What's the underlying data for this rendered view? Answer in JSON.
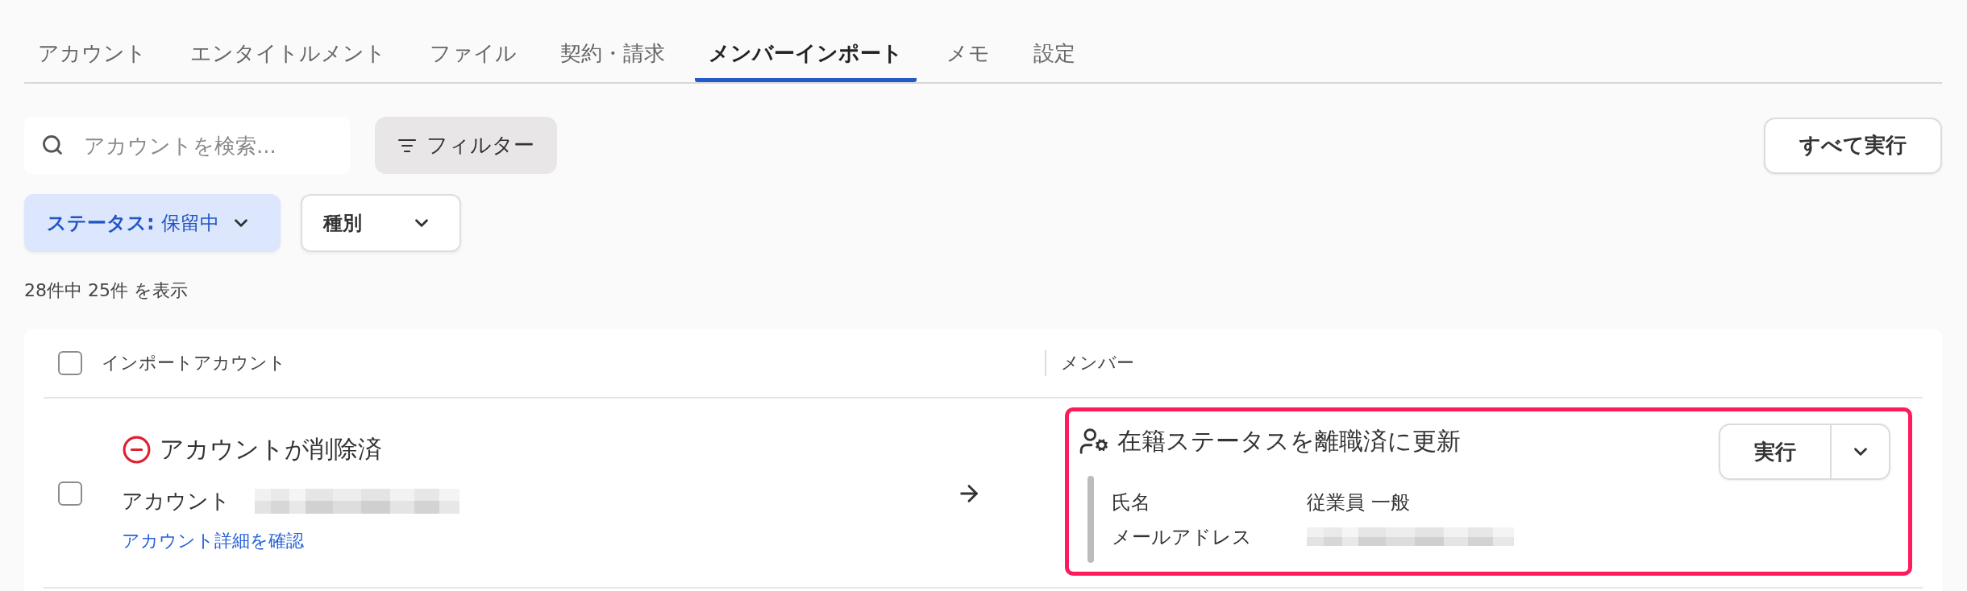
{
  "tabs": [
    {
      "label": "アカウント",
      "selected": false
    },
    {
      "label": "エンタイトルメント",
      "selected": false
    },
    {
      "label": "ファイル",
      "selected": false
    },
    {
      "label": "契約・請求",
      "selected": false
    },
    {
      "label": "メンバーインポート",
      "selected": true
    },
    {
      "label": "メモ",
      "selected": false
    },
    {
      "label": "設定",
      "selected": false
    }
  ],
  "toolbar": {
    "search": {
      "placeholder": "アカウントを検索..."
    },
    "filter_button": {
      "label": "フィルター"
    },
    "run_all_button": {
      "label": "すべて実行"
    }
  },
  "filters": [
    {
      "label": "ステータス:",
      "value": "保留中",
      "active": true
    },
    {
      "label": "種別",
      "active": false
    }
  ],
  "result_count": "28件中 25件 を表示",
  "table": {
    "columns": [
      "インポートアカウント",
      "メンバー"
    ],
    "select_all": {
      "checked": false
    },
    "rows": [
      {
        "checked": false,
        "account": {
          "status": {
            "kind": "deleted",
            "label": "アカウントが削除済"
          },
          "label": "アカウント",
          "value_redacted": true,
          "detail_link": "アカウント詳細を確認"
        },
        "member": {
          "highlighted": true,
          "action": "在籍ステータスを離職済に更新",
          "fields": [
            {
              "label": "氏名",
              "value": "従業員 一般",
              "redacted": false
            },
            {
              "label": "メールアドレス",
              "redacted": true
            }
          ],
          "run_button": {
            "label": "実行"
          }
        }
      }
    ]
  }
}
